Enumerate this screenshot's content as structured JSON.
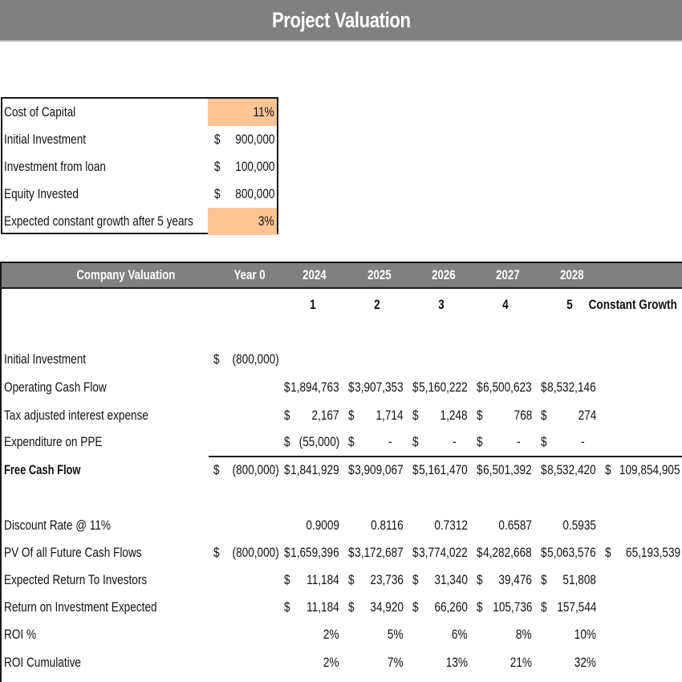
{
  "title": "Project Valuation",
  "assumptions": [
    {
      "label": "Cost of Capital",
      "currency": "",
      "value": "11%",
      "highlight": true
    },
    {
      "label": "Initial Investment",
      "currency": "$",
      "value": "900,000",
      "highlight": false
    },
    {
      "label": "Investment from loan",
      "currency": "$",
      "value": "100,000",
      "highlight": false
    },
    {
      "label": "Equity Invested",
      "currency": "$",
      "value": "800,000",
      "highlight": false
    },
    {
      "label": "Expected constant growth after 5 years",
      "currency": "",
      "value": "3%",
      "highlight": true
    }
  ],
  "colors": {
    "header_bg": "#808080",
    "highlight": "#fcc595"
  },
  "valuation": {
    "header": {
      "label": "Company Valuation",
      "columns": [
        "Year 0",
        "2024",
        "2025",
        "2026",
        "2027",
        "2028",
        ""
      ]
    },
    "index_row": [
      "",
      "1",
      "2",
      "3",
      "4",
      "5",
      "Constant Growth"
    ],
    "rows": [
      {
        "label": "Initial Investment",
        "bold": false,
        "cells": [
          {
            "cur": "$",
            "val": "(800,000)"
          },
          null,
          null,
          null,
          null,
          null,
          null
        ]
      },
      {
        "label": "Operating Cash Flow",
        "bold": false,
        "cells": [
          null,
          {
            "cur": "$",
            "val": "1,894,763"
          },
          {
            "cur": "$",
            "val": "3,907,353"
          },
          {
            "cur": "$",
            "val": "5,160,222"
          },
          {
            "cur": "$",
            "val": "6,500,623"
          },
          {
            "cur": "$",
            "val": "8,532,146"
          },
          null
        ]
      },
      {
        "label": "Tax adjusted interest expense",
        "bold": false,
        "cells": [
          null,
          {
            "cur": "$",
            "val": "2,167"
          },
          {
            "cur": "$",
            "val": "1,714"
          },
          {
            "cur": "$",
            "val": "1,248"
          },
          {
            "cur": "$",
            "val": "768"
          },
          {
            "cur": "$",
            "val": "274"
          },
          null
        ]
      },
      {
        "label": "Expenditure on PPE",
        "bold": false,
        "cells": [
          null,
          {
            "cur": "$",
            "val": "(55,000)"
          },
          {
            "cur": "$",
            "val": "-",
            "center": true
          },
          {
            "cur": "$",
            "val": "-",
            "center": true
          },
          {
            "cur": "$",
            "val": "-",
            "center": true
          },
          {
            "cur": "$",
            "val": "-",
            "center": true
          },
          null
        ]
      },
      {
        "label": "Free Cash Flow",
        "bold": true,
        "cells": [
          {
            "cur": "$",
            "val": "(800,000)"
          },
          {
            "cur": "$",
            "val": "1,841,929"
          },
          {
            "cur": "$",
            "val": "3,909,067"
          },
          {
            "cur": "$",
            "val": "5,161,470"
          },
          {
            "cur": "$",
            "val": "6,501,392"
          },
          {
            "cur": "$",
            "val": "8,532,420"
          },
          {
            "cur": "$",
            "val": "109,854,905"
          }
        ]
      },
      {
        "label": "Discount Rate @ 11%",
        "bold": false,
        "cells": [
          null,
          {
            "cur": "",
            "val": "0.9009"
          },
          {
            "cur": "",
            "val": "0.8116"
          },
          {
            "cur": "",
            "val": "0.7312"
          },
          {
            "cur": "",
            "val": "0.6587"
          },
          {
            "cur": "",
            "val": "0.5935"
          },
          null
        ]
      },
      {
        "label": "PV Of all Future Cash Flows",
        "bold": false,
        "cells": [
          {
            "cur": "$",
            "val": "(800,000)"
          },
          {
            "cur": "$",
            "val": "1,659,396"
          },
          {
            "cur": "$",
            "val": "3,172,687"
          },
          {
            "cur": "$",
            "val": "3,774,022"
          },
          {
            "cur": "$",
            "val": "4,282,668"
          },
          {
            "cur": "$",
            "val": "5,063,576"
          },
          {
            "cur": "$",
            "val": "65,193,539"
          }
        ]
      },
      {
        "label": "Expected Return To Investors",
        "bold": false,
        "cells": [
          null,
          {
            "cur": "$",
            "val": "11,184"
          },
          {
            "cur": "$",
            "val": "23,736"
          },
          {
            "cur": "$",
            "val": "31,340"
          },
          {
            "cur": "$",
            "val": "39,476"
          },
          {
            "cur": "$",
            "val": "51,808"
          },
          null
        ]
      },
      {
        "label": "Return on Investment Expected",
        "bold": false,
        "cells": [
          null,
          {
            "cur": "$",
            "val": "11,184"
          },
          {
            "cur": "$",
            "val": "34,920"
          },
          {
            "cur": "$",
            "val": "66,260"
          },
          {
            "cur": "$",
            "val": "105,736"
          },
          {
            "cur": "$",
            "val": "157,544"
          },
          null
        ]
      },
      {
        "label": "ROI %",
        "bold": false,
        "cells": [
          null,
          {
            "cur": "",
            "val": "2%"
          },
          {
            "cur": "",
            "val": "5%"
          },
          {
            "cur": "",
            "val": "6%"
          },
          {
            "cur": "",
            "val": "8%"
          },
          {
            "cur": "",
            "val": "10%"
          },
          null
        ]
      },
      {
        "label": "ROI Cumulative",
        "bold": false,
        "cells": [
          null,
          {
            "cur": "",
            "val": "2%"
          },
          {
            "cur": "",
            "val": "7%"
          },
          {
            "cur": "",
            "val": "13%"
          },
          {
            "cur": "",
            "val": "21%"
          },
          {
            "cur": "",
            "val": "32%"
          },
          null
        ]
      }
    ]
  }
}
